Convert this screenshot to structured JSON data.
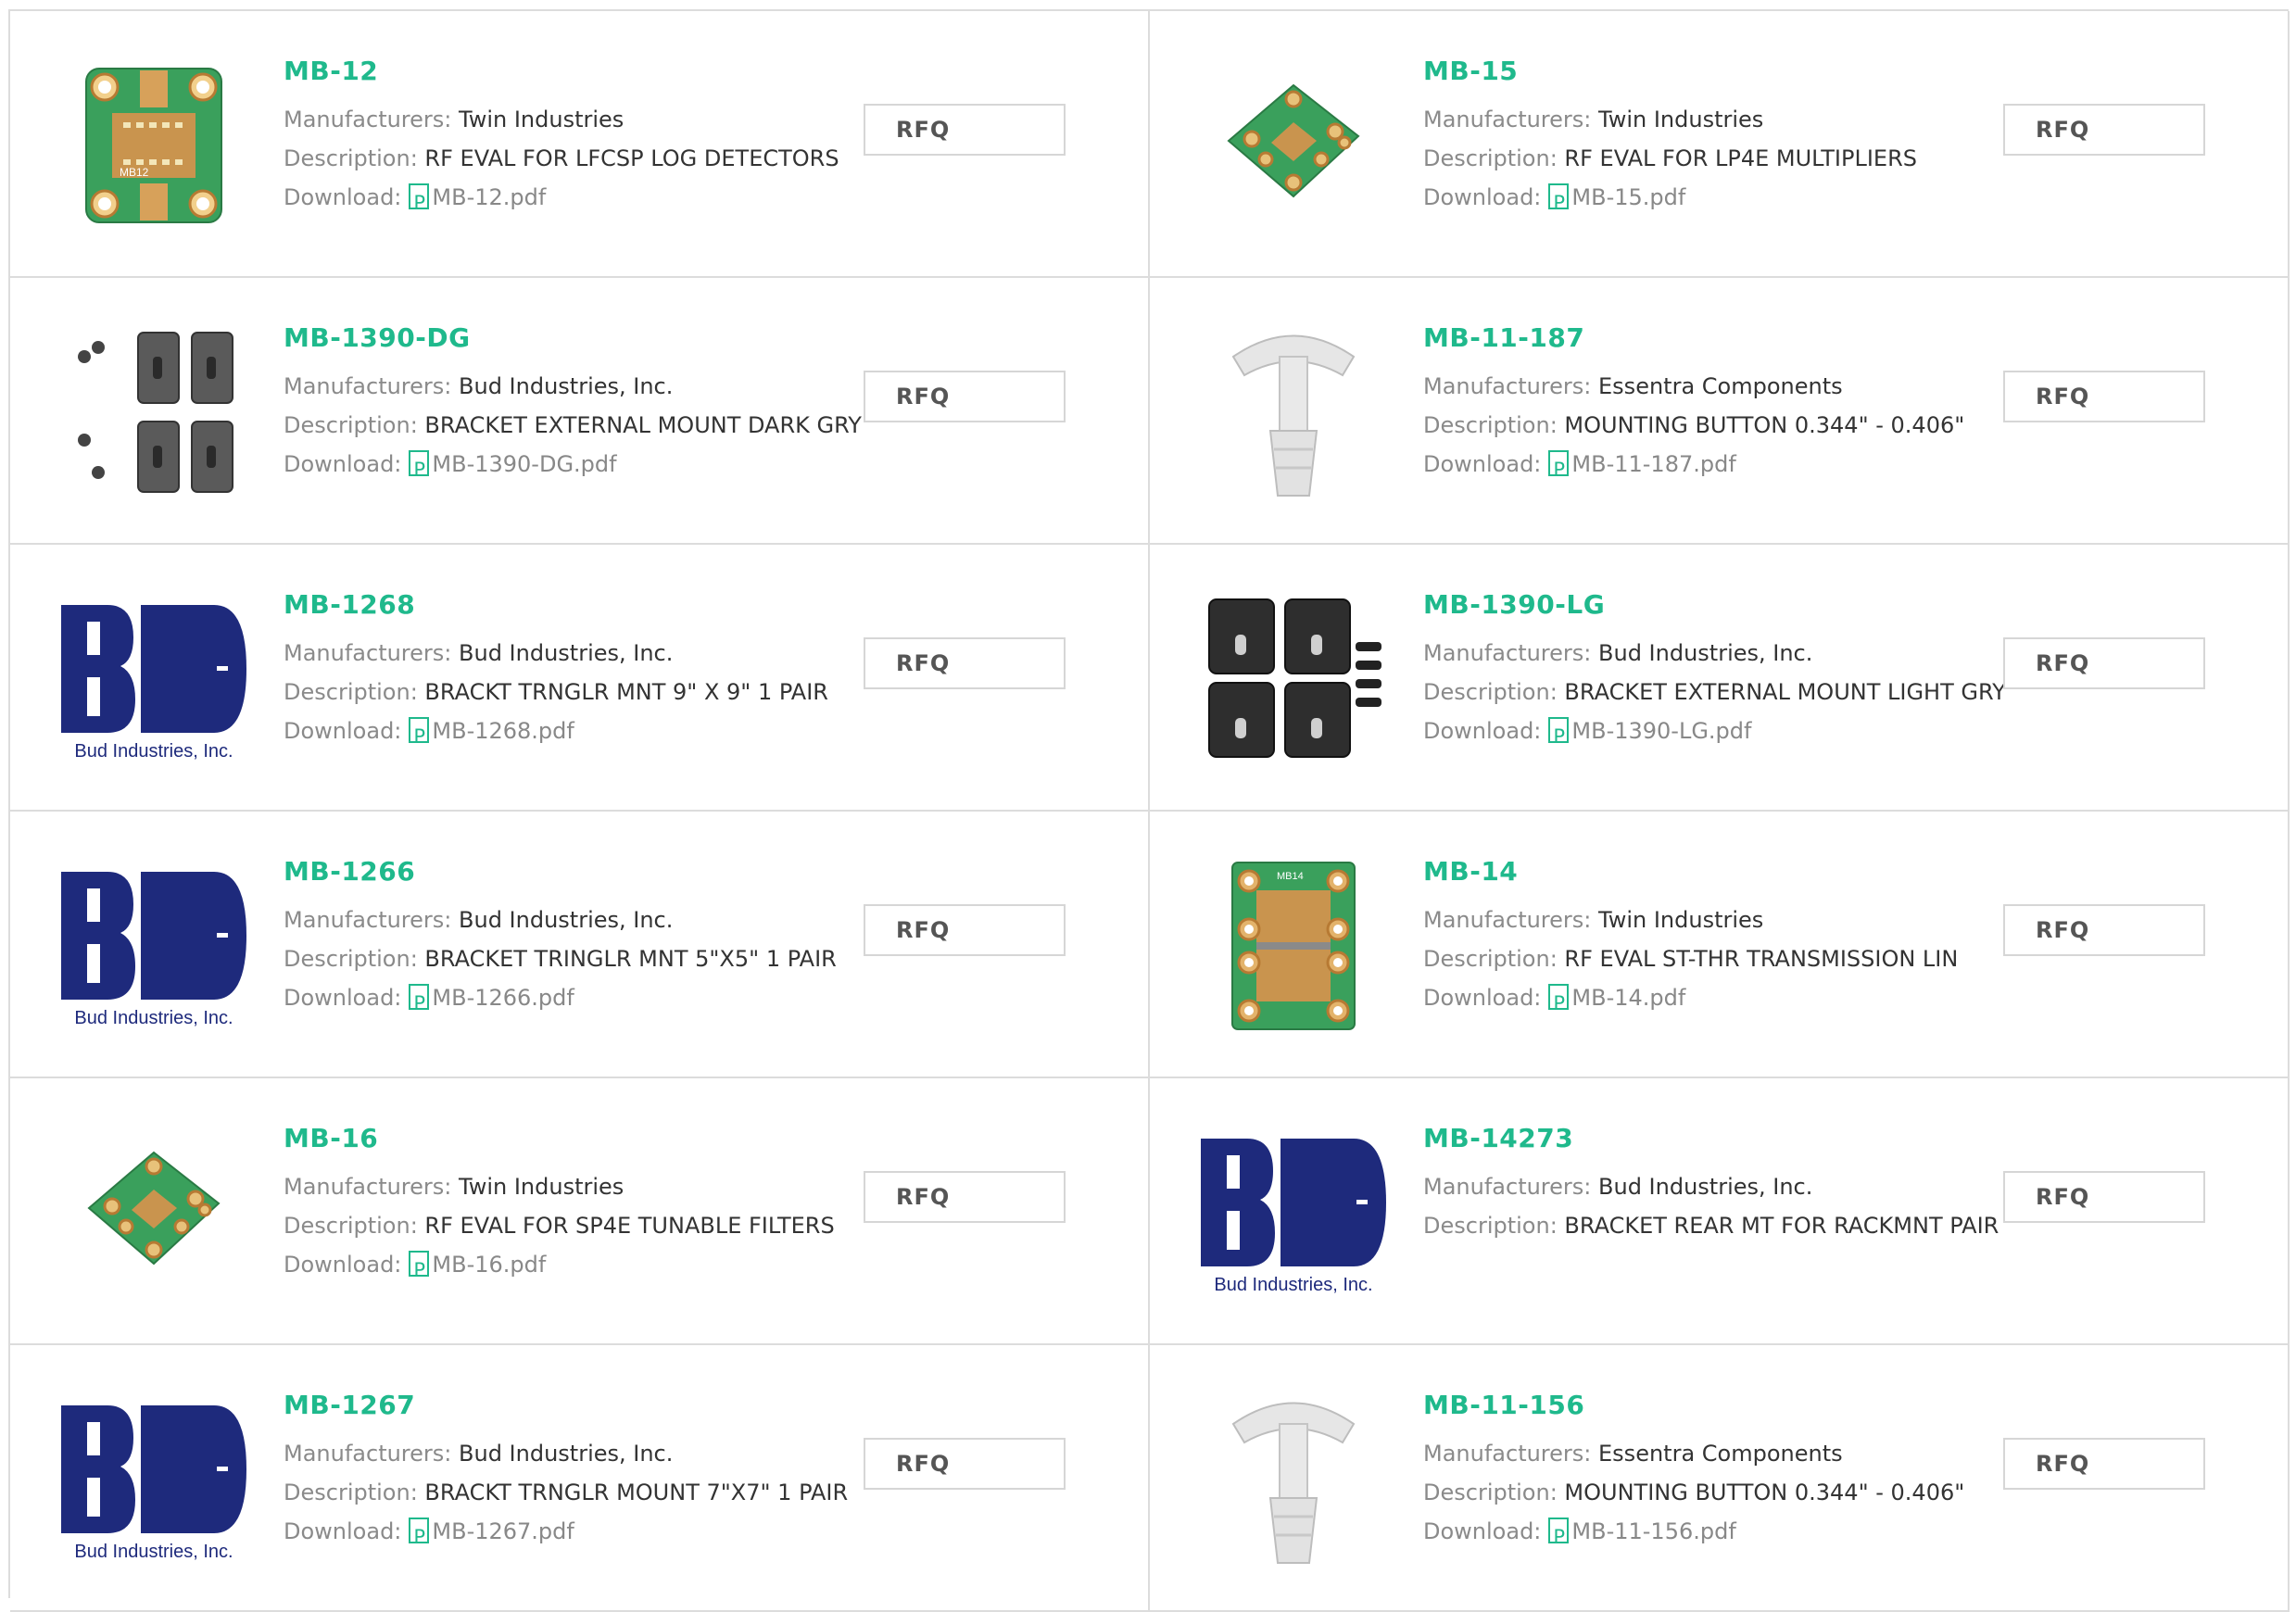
{
  "labels": {
    "manufacturers": "Manufacturers:",
    "description": "Description:",
    "download": "Download:",
    "rfq": "RFQ"
  },
  "colors": {
    "accent": "#1fb98c",
    "bud_blue": "#1e2a7c",
    "pcb_green": "#3b9e5a",
    "border": "#dcdcdc"
  },
  "products": [
    {
      "part": "MB-12",
      "manufacturer": "Twin Industries",
      "description": "RF EVAL FOR LFCSP LOG DETECTORS",
      "download": "MB-12.pdf",
      "image": "pcb-board-mb12",
      "image_label": "MB12"
    },
    {
      "part": "MB-15",
      "manufacturer": "Twin Industries",
      "description": "RF EVAL FOR LP4E MULTIPLIERS",
      "download": "MB-15.pdf",
      "image": "pcb-board-small",
      "image_label": ""
    },
    {
      "part": "MB-1390-DG",
      "manufacturer": "Bud Industries, Inc.",
      "description": "BRACKET EXTERNAL MOUNT DARK GRY",
      "download": "MB-1390-DG.pdf",
      "image": "bracket-set-dark",
      "image_label": ""
    },
    {
      "part": "MB-11-187",
      "manufacturer": "Essentra Components",
      "description": "MOUNTING BUTTON 0.344\" - 0.406\"",
      "download": "MB-11-187.pdf",
      "image": "mounting-button",
      "image_label": ""
    },
    {
      "part": "MB-1268",
      "manufacturer": "Bud Industries, Inc.",
      "description": "BRACKT TRNGLR MNT 9\" X 9\" 1 PAIR",
      "download": "MB-1268.pdf",
      "image": "bud-logo",
      "image_label": "Bud Industries, Inc."
    },
    {
      "part": "MB-1390-LG",
      "manufacturer": "Bud Industries, Inc.",
      "description": "BRACKET EXTERNAL MOUNT LIGHT GRY",
      "download": "MB-1390-LG.pdf",
      "image": "bracket-set-black",
      "image_label": ""
    },
    {
      "part": "MB-1266",
      "manufacturer": "Bud Industries, Inc.",
      "description": "BRACKET TRINGLR MNT 5\"X5\" 1 PAIR",
      "download": "MB-1266.pdf",
      "image": "bud-logo",
      "image_label": "Bud Industries, Inc."
    },
    {
      "part": "MB-14",
      "manufacturer": "Twin Industries",
      "description": "RF EVAL ST-THR TRANSMISSION LIN",
      "download": "MB-14.pdf",
      "image": "pcb-board-mb14",
      "image_label": "MB14"
    },
    {
      "part": "MB-16",
      "manufacturer": "Twin Industries",
      "description": "RF EVAL FOR SP4E TUNABLE FILTERS",
      "download": "MB-16.pdf",
      "image": "pcb-board-small",
      "image_label": ""
    },
    {
      "part": "MB-14273",
      "manufacturer": "Bud Industries, Inc.",
      "description": "BRACKET REAR MT FOR RACKMNT PAIR",
      "download": "",
      "image": "bud-logo",
      "image_label": "Bud Industries, Inc."
    },
    {
      "part": "MB-1267",
      "manufacturer": "Bud Industries, Inc.",
      "description": "BRACKT TRNGLR MOUNT 7\"X7\" 1 PAIR",
      "download": "MB-1267.pdf",
      "image": "bud-logo",
      "image_label": "Bud Industries, Inc."
    },
    {
      "part": "MB-11-156",
      "manufacturer": "Essentra Components",
      "description": "MOUNTING BUTTON 0.344\" - 0.406\"",
      "download": "MB-11-156.pdf",
      "image": "mounting-button",
      "image_label": ""
    }
  ]
}
